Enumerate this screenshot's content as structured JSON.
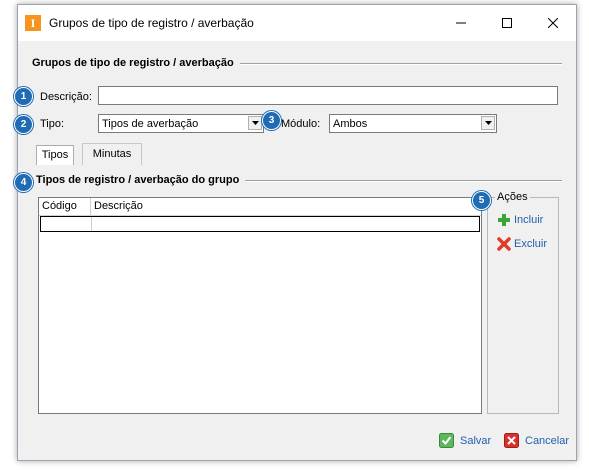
{
  "window": {
    "app_icon_letter": "I",
    "title": "Grupos de tipo de registro / averbação"
  },
  "form": {
    "group_title": "Grupos de tipo de registro / averbação",
    "descricao_label": "Descrição:",
    "descricao_value": "",
    "tipo_label": "Tipo:",
    "tipo_value": "Tipos de averbação",
    "modulo_label": "Módulo:",
    "modulo_value": "Ambos"
  },
  "tabs": [
    {
      "label": "Tipos",
      "active": true
    },
    {
      "label": "Minutas",
      "active": false
    }
  ],
  "list": {
    "title": "Tipos de registro / averbação do grupo",
    "columns": [
      "Código",
      "Descrição"
    ],
    "rows": [
      [
        "",
        ""
      ]
    ]
  },
  "actions": {
    "title": "Ações",
    "incluir": "Incluir",
    "excluir": "Excluir"
  },
  "footer": {
    "salvar": "Salvar",
    "cancelar": "Cancelar"
  },
  "badges": [
    "1",
    "2",
    "3",
    "4",
    "5"
  ],
  "colors": {
    "badge": "#1f6bb4",
    "link": "#1f5fae",
    "app_icon": "#f7941d",
    "add_icon": "#3aa635",
    "delete_icon": "#e03c2a"
  }
}
